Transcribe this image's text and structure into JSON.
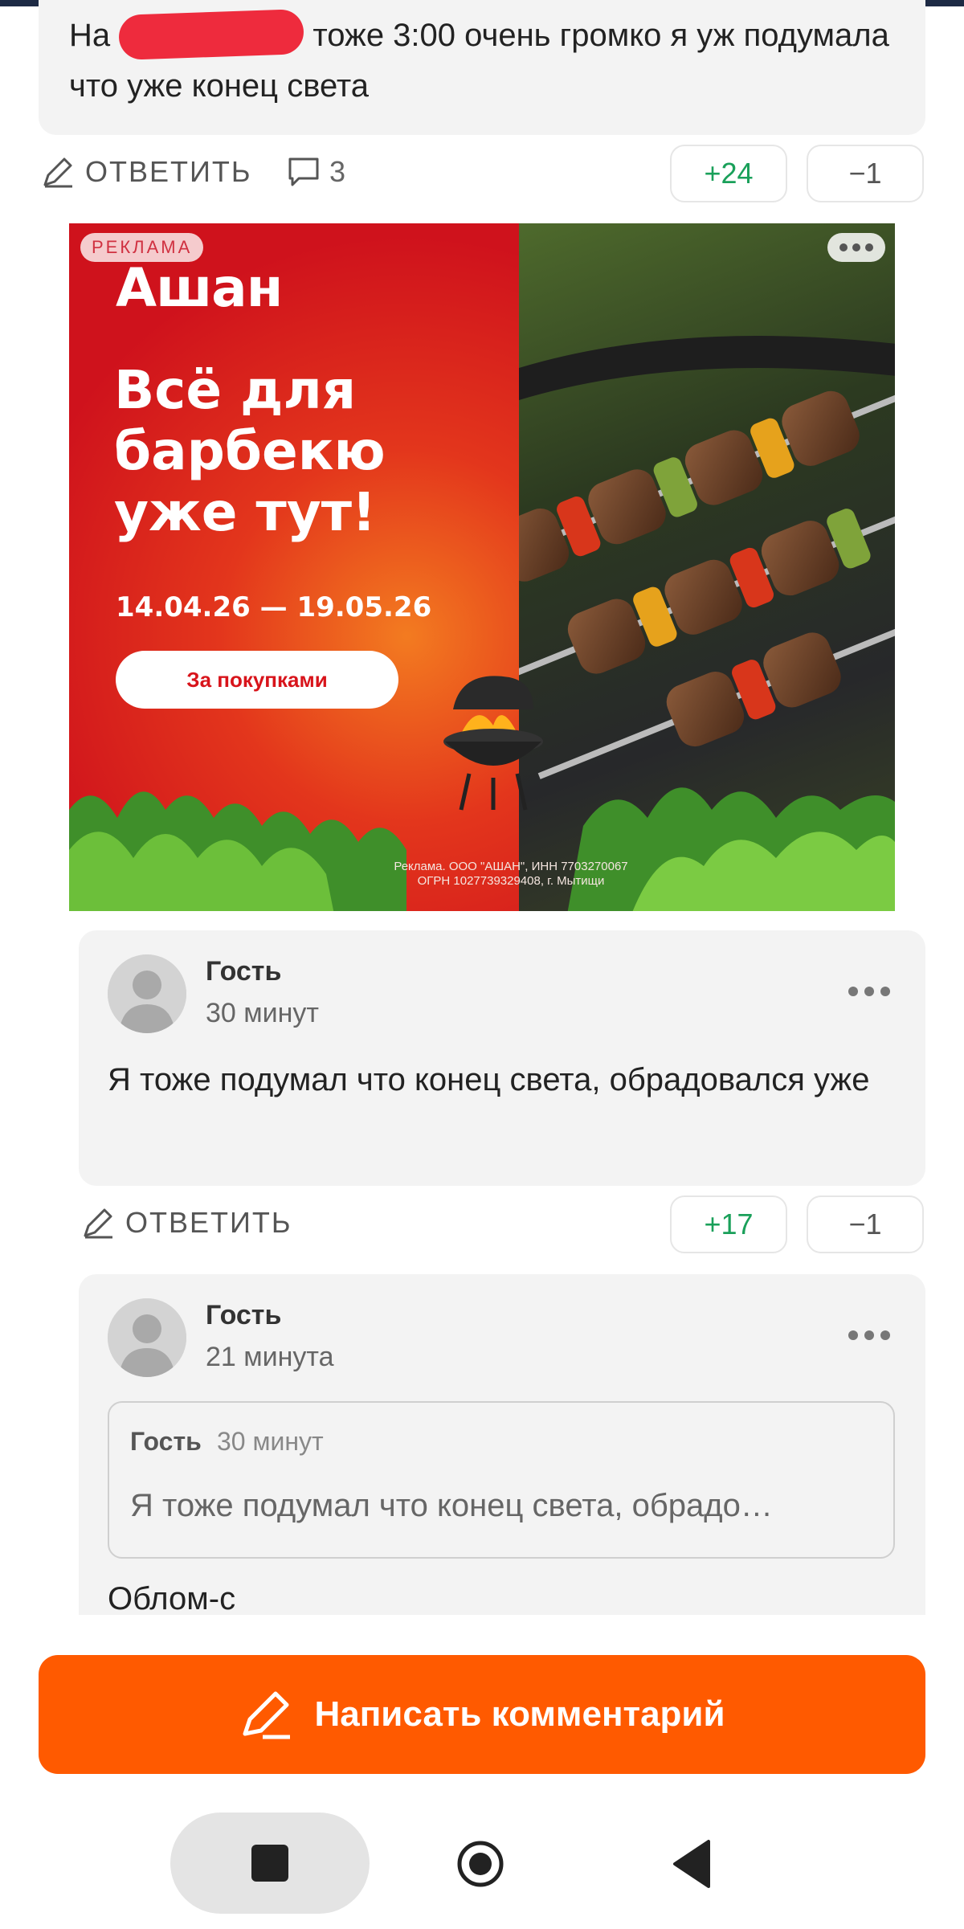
{
  "comment_top": {
    "text_before": "На",
    "text_after": "тоже 3:00 очень громко я уж подумала что уже конец света"
  },
  "action_row_1": {
    "reply_label": "ОТВЕТИТЬ",
    "replies_count": "3",
    "upvotes": "+24",
    "downvotes": "−1"
  },
  "ad": {
    "badge": "РЕКЛАМА",
    "brand": "Ашан",
    "headline": "Всё для барбекю уже тут!",
    "dates": "14.04.26 — 19.05.26",
    "cta": "За покупками",
    "legal_line1": "Реклама. ООО \"АШАН\", ИНН 7703270067",
    "legal_line2": "ОГРН 1027739329408, г. Мытищи"
  },
  "comment_2": {
    "author": "Гость",
    "time": "30 минут",
    "text": "Я тоже подумал что конец света, обрадовался уже"
  },
  "action_row_2": {
    "reply_label": "ОТВЕТИТЬ",
    "upvotes": "+17",
    "downvotes": "−1"
  },
  "comment_3": {
    "author": "Гость",
    "time": "21 минута",
    "quote": {
      "author": "Гость",
      "time": "30 минут",
      "text": "Я тоже подумал что конец света, обрадо…"
    },
    "text": "Облом-с"
  },
  "write_button": {
    "label": "Написать комментарий"
  },
  "colors": {
    "accent": "#ff5a00",
    "upvote": "#1aa05a",
    "ad_red": "#d8141b",
    "card_bg": "#f3f3f3"
  },
  "icons": [
    "pencil-icon",
    "comment-bubble-icon",
    "more-dots-icon",
    "avatar-placeholder-icon",
    "nav-square-icon",
    "nav-circle-icon",
    "nav-back-icon"
  ]
}
